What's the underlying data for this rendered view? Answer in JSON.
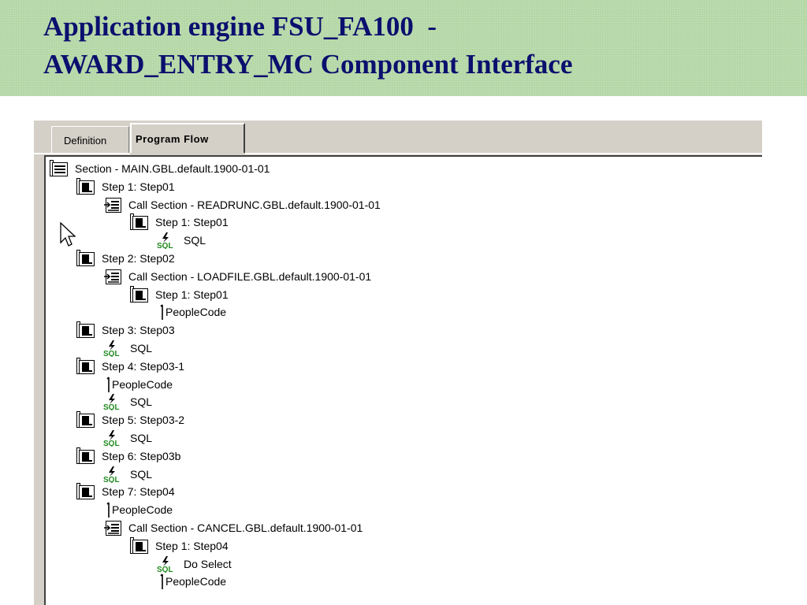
{
  "title": {
    "line1": "Application engine FSU_FA100  -",
    "line2": "AWARD_ENTRY_MC Component Interface"
  },
  "tabs": [
    {
      "label": "Definition",
      "active": false
    },
    {
      "label": "Program Flow",
      "active": true
    }
  ],
  "tree": {
    "nodes": [
      {
        "label": "Section - MAIN.GBL.default.1900-01-01",
        "icon": "section-icon",
        "depth": 0
      },
      {
        "label": "Step 1: Step01",
        "icon": "step-icon",
        "depth": 1
      },
      {
        "label": "Call Section - READRUNC.GBL.default.1900-01-01",
        "icon": "call-section-icon",
        "depth": 2
      },
      {
        "label": "Step 1: Step01",
        "icon": "step-icon",
        "depth": 3
      },
      {
        "label": "SQL",
        "icon": "sql-icon",
        "depth": 4
      },
      {
        "label": "Step 2: Step02",
        "icon": "step-icon",
        "depth": 1
      },
      {
        "label": "Call Section - LOADFILE.GBL.default.1900-01-01",
        "icon": "call-section-icon",
        "depth": 2
      },
      {
        "label": "Step 1: Step01",
        "icon": "step-icon",
        "depth": 3
      },
      {
        "label": "PeopleCode",
        "icon": "peoplecode-icon",
        "depth": 4
      },
      {
        "label": "Step 3: Step03",
        "icon": "step-icon",
        "depth": 1
      },
      {
        "label": "SQL",
        "icon": "sql-icon",
        "depth": 2
      },
      {
        "label": "Step 4: Step03-1",
        "icon": "step-icon",
        "depth": 1
      },
      {
        "label": "PeopleCode",
        "icon": "peoplecode-icon",
        "depth": 2
      },
      {
        "label": "SQL",
        "icon": "sql-icon",
        "depth": 2
      },
      {
        "label": "Step 5: Step03-2",
        "icon": "step-icon",
        "depth": 1
      },
      {
        "label": "SQL",
        "icon": "sql-icon",
        "depth": 2
      },
      {
        "label": "Step 6: Step03b",
        "icon": "step-icon",
        "depth": 1
      },
      {
        "label": "SQL",
        "icon": "sql-icon",
        "depth": 2
      },
      {
        "label": "Step 7: Step04",
        "icon": "step-icon",
        "depth": 1
      },
      {
        "label": "PeopleCode",
        "icon": "peoplecode-icon",
        "depth": 2
      },
      {
        "label": "Call Section - CANCEL.GBL.default.1900-01-01",
        "icon": "call-section-icon",
        "depth": 2
      },
      {
        "label": "Step 1: Step04",
        "icon": "step-icon",
        "depth": 3
      },
      {
        "label": "Do Select",
        "icon": "sql-icon",
        "depth": 4
      },
      {
        "label": "PeopleCode",
        "icon": "peoplecode-icon",
        "depth": 4
      }
    ]
  },
  "colors": {
    "banner": "#b3d7a5",
    "title_text": "#0b0f6e",
    "window": "#d4d0c8",
    "sql_green": "#1e8a1e"
  }
}
